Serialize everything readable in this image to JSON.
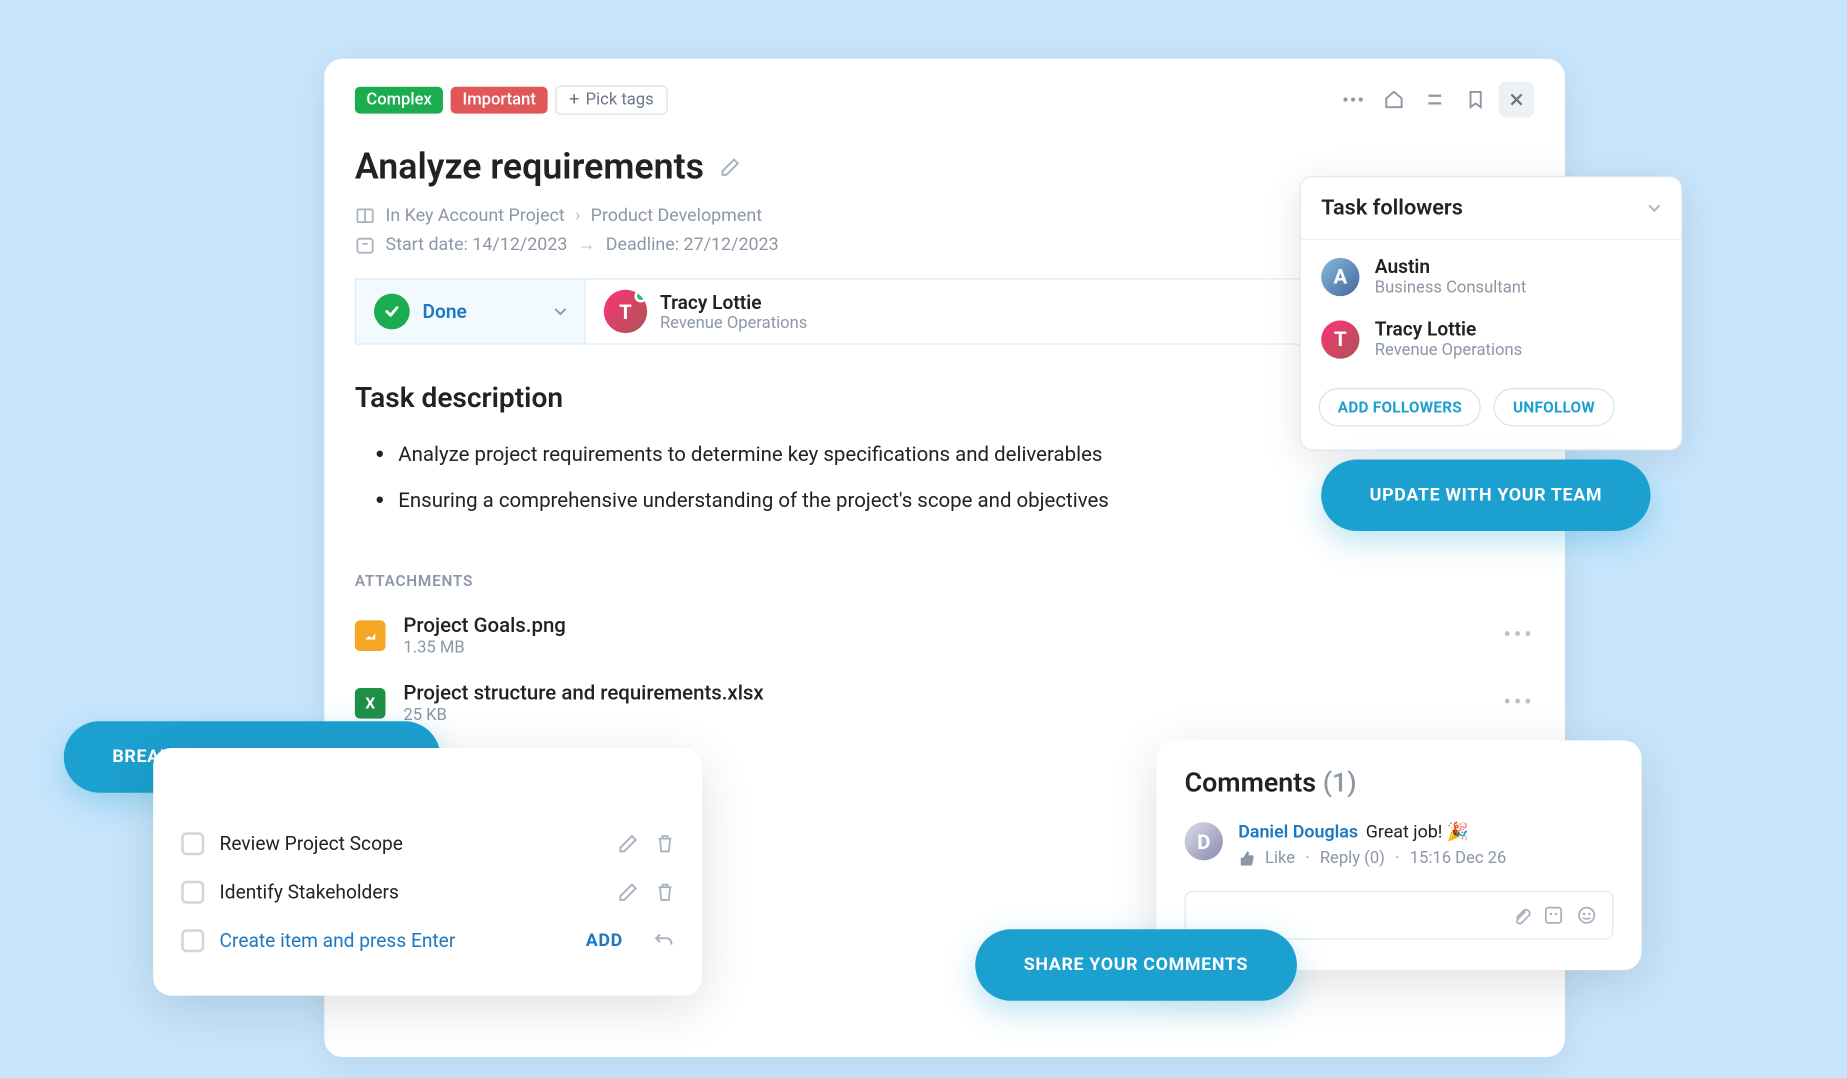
{
  "tags": [
    "Complex",
    "Important"
  ],
  "pick_tags_label": "Pick tags",
  "title": "Analyze requirements",
  "breadcrumb": {
    "project": "In Key Account Project",
    "section": "Product Development"
  },
  "dates": {
    "start_label": "Start date: 14/12/2023",
    "deadline_label": "Deadline: 27/12/2023"
  },
  "status": {
    "label": "Done"
  },
  "assignee": {
    "name": "Tracy Lottie",
    "role": "Revenue Operations"
  },
  "description_title": "Task description",
  "description_items": [
    "Analyze project requirements to determine key specifications and deliverables",
    "Ensuring a comprehensive understanding of the project's scope and objectives"
  ],
  "attachments_label": "ATTACHMENTS",
  "attachments": [
    {
      "name": "Project Goals.png",
      "size": "1.35 MB",
      "type": "img"
    },
    {
      "name": "Project structure and requirements.xlsx",
      "size": "25 KB",
      "type": "xls"
    }
  ],
  "followers": {
    "title": "Task followers",
    "items": [
      {
        "name": "Austin",
        "role": "Business Consultant"
      },
      {
        "name": "Tracy Lottie",
        "role": "Revenue Operations"
      }
    ],
    "add_label": "ADD FOLLOWERS",
    "unfollow_label": "UNFOLLOW"
  },
  "callouts": {
    "update": "UPDATE WITH YOUR TEAM",
    "break": "BREAK YOUR TASK TO ACTIONS",
    "share": "SHARE YOUR COMMENTS"
  },
  "subtasks": {
    "items": [
      "Review Project Scope",
      "Identify Stakeholders"
    ],
    "create_placeholder": "Create item and press Enter",
    "add_label": "ADD"
  },
  "comments": {
    "title": "Comments ",
    "count": "(1)",
    "list": [
      {
        "author": "Daniel Douglas",
        "text": "Great job! 🎉",
        "like": "Like",
        "reply": "Reply (0)",
        "time": "15:16 Dec 26"
      }
    ]
  }
}
